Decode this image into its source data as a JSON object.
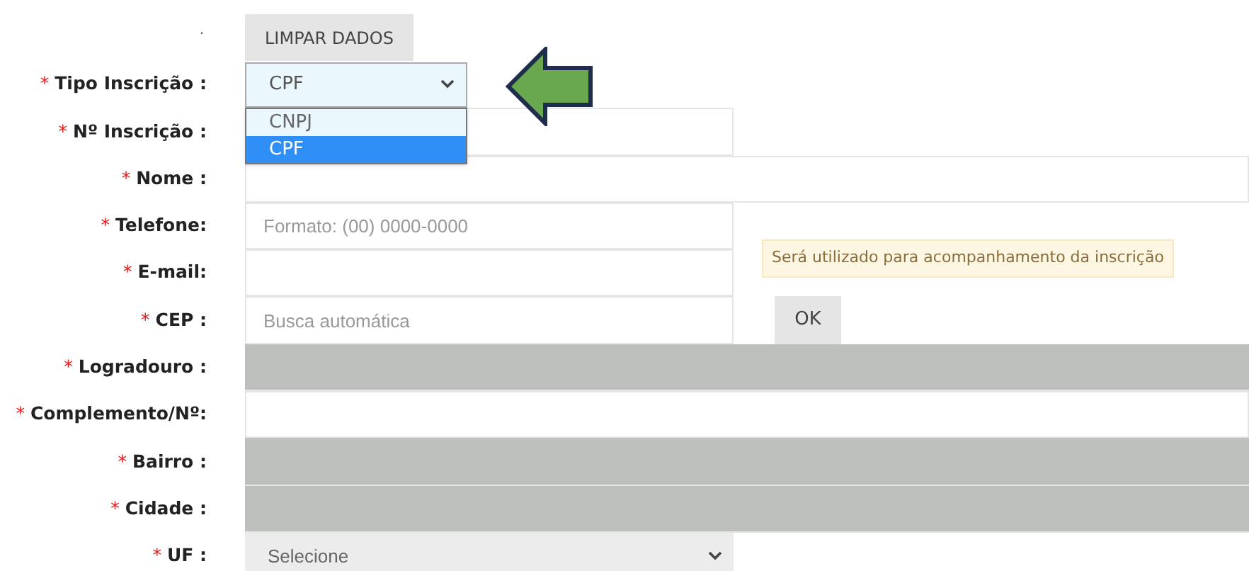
{
  "top_label": ".",
  "required_mark": "*",
  "clear_button": "LIMPAR DADOS",
  "type_select": {
    "value": "CPF",
    "options": [
      {
        "label": "CNPJ",
        "selected": false
      },
      {
        "label": "CPF",
        "selected": true
      }
    ],
    "expanded": true
  },
  "fields": [
    {
      "label": "Tipo Inscrição :",
      "required": true,
      "kind": "type-select"
    },
    {
      "label": "Nº Inscrição :",
      "required": true,
      "kind": "field"
    },
    {
      "label": "Nome :",
      "required": true,
      "kind": "wide-field"
    },
    {
      "label": "Telefone:",
      "required": true,
      "kind": "field",
      "placeholder": "Formato: (00) 0000-0000"
    },
    {
      "label": "E-mail:",
      "required": true,
      "kind": "field",
      "hint": "Será utilizado para acompanhamento da inscrição"
    },
    {
      "label": "CEP :",
      "required": true,
      "kind": "field",
      "placeholder": "Busca automática",
      "button": "OK"
    },
    {
      "label": "Logradouro :",
      "required": true,
      "kind": "locked"
    },
    {
      "label": "Complemento/Nº:",
      "required": true,
      "kind": "wide-field"
    },
    {
      "label": "Bairro :",
      "required": true,
      "kind": "locked"
    },
    {
      "label": "Cidade :",
      "required": true,
      "kind": "locked"
    },
    {
      "label": "UF :",
      "required": true,
      "kind": "select",
      "value": "Selecione"
    }
  ]
}
